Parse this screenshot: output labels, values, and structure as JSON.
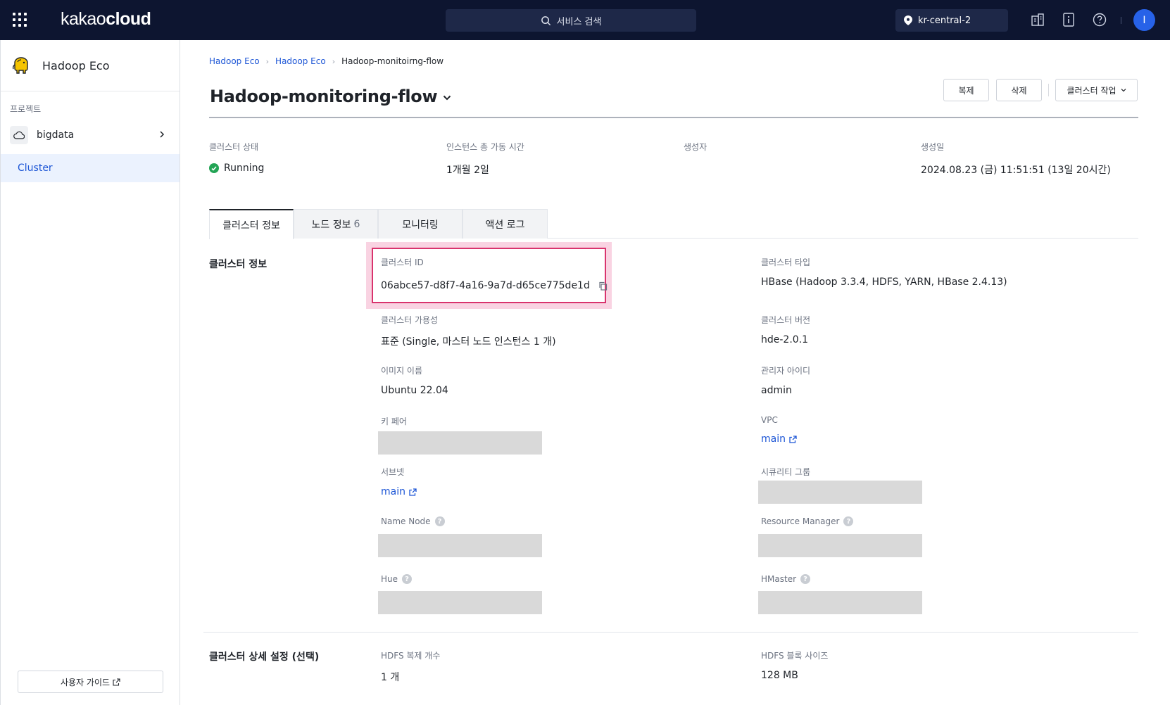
{
  "topbar": {
    "logo_light": "kakao",
    "logo_bold": "cloud",
    "search_placeholder": "서비스 검색",
    "region": "kr-central-2",
    "avatar_initial": "I"
  },
  "sidebar": {
    "service_name": "Hadoop Eco",
    "project_label": "프로젝트",
    "project_name": "bigdata",
    "nav_items": [
      {
        "label": "Cluster",
        "active": true
      }
    ],
    "guide_label": "사용자 가이드"
  },
  "breadcrumb": [
    "Hadoop Eco",
    "Hadoop Eco",
    "Hadoop-monitoirng-flow"
  ],
  "page": {
    "title": "Hadoop-monitoring-flow",
    "actions": {
      "copy": "복제",
      "delete": "삭제",
      "cluster_task": "클러스터 작업"
    }
  },
  "summary": [
    {
      "label": "클러스터 상태",
      "value": "Running"
    },
    {
      "label": "인스턴스 총 가동 시간",
      "value": "1개월 2일"
    },
    {
      "label": "생성자",
      "value": ""
    },
    {
      "label": "생성일",
      "value": "2024.08.23 (금) 11:51:51 (13일 20시간)"
    }
  ],
  "tabs": [
    {
      "label": "클러스터 정보",
      "active": true,
      "count": ""
    },
    {
      "label": "노드 정보",
      "active": false,
      "count": "6"
    },
    {
      "label": "모니터링",
      "active": false,
      "count": ""
    },
    {
      "label": "액션 로그",
      "active": false,
      "count": ""
    }
  ],
  "cluster_info": {
    "section_title": "클러스터 정보",
    "cluster_id_label": "클러스터 ID",
    "cluster_id": "06abce57-d8f7-4a16-9a7d-d65ce775de1d",
    "cluster_type_label": "클러스터 타입",
    "cluster_type": "HBase (Hadoop 3.3.4, HDFS, YARN, HBase 2.4.13)",
    "availability_label": "클러스터 가용성",
    "availability": "표준 (Single, 마스터 노드 인스턴스 1 개)",
    "version_label": "클러스터 버전",
    "version": "hde-2.0.1",
    "image_label": "이미지 이름",
    "image": "Ubuntu 22.04",
    "admin_label": "관리자 아이디",
    "admin": "admin",
    "keypair_label": "키 페어",
    "vpc_label": "VPC",
    "vpc": "main",
    "subnet_label": "서브넷",
    "subnet": "main",
    "security_group_label": "시큐리티 그룹",
    "name_node_label": "Name Node",
    "resource_manager_label": "Resource Manager",
    "hue_label": "Hue",
    "hmaster_label": "HMaster"
  },
  "advanced": {
    "section_title": "클러스터 상세 설정 (선택)",
    "hdfs_replication_label": "HDFS 복제 개수",
    "hdfs_replication": "1 개",
    "hdfs_block_label": "HDFS 블록 사이즈",
    "hdfs_block": "128 MB"
  },
  "colors": {
    "topbar_bg": "#0d1530",
    "link": "#1d56d6",
    "status_running": "#23a455",
    "highlight_border": "#d9336d",
    "highlight_fill": "#f9d3e2"
  }
}
